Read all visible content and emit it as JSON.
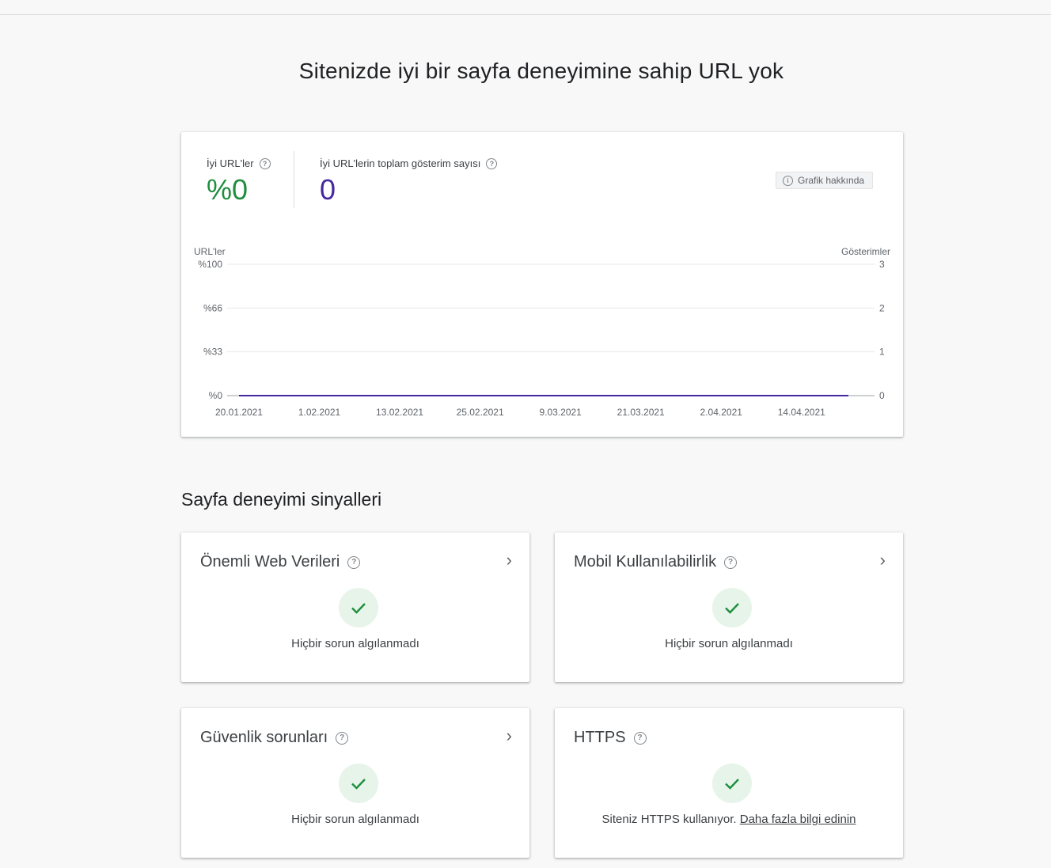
{
  "page": {
    "title": "Sitenizde iyi bir sayfa deneyimine sahip URL yok"
  },
  "summary": {
    "good_urls_label": "İyi URL'ler",
    "good_urls_value": "%0",
    "impressions_label": "İyi URL'lerin toplam gösterim sayısı",
    "impressions_value": "0",
    "about_chart_label": "Grafik hakkında"
  },
  "colors": {
    "good_green": "#1e8e3e",
    "impressions_purple": "#4527a0",
    "check_green": "#1e8e3e",
    "check_bg": "#e6f4ea"
  },
  "chart_data": {
    "type": "line",
    "left_axis_label": "URL'ler",
    "right_axis_label": "Gösterimler",
    "left_ticks": [
      "%100",
      "%66",
      "%33",
      "%0"
    ],
    "right_ticks": [
      "3",
      "2",
      "1",
      "0"
    ],
    "x_tick_labels": [
      "20.01.2021",
      "1.02.2021",
      "13.02.2021",
      "25.02.2021",
      "9.03.2021",
      "21.03.2021",
      "2.04.2021",
      "14.04.2021"
    ],
    "x_range": [
      "20.01.2021",
      "21.04.2021"
    ],
    "ylim_left": [
      0,
      100
    ],
    "ylim_right": [
      0,
      3
    ],
    "grid": true,
    "series": [
      {
        "axis": "right",
        "color": "#4527a0",
        "x": [
          "20.01.2021",
          "21.04.2021"
        ],
        "values": [
          0,
          0
        ]
      }
    ]
  },
  "signals": {
    "section_title": "Sayfa deneyimi sinyalleri",
    "items": [
      {
        "title": "Önemli Web Verileri",
        "status": "Hiçbir sorun algılanmadı",
        "has_chevron": true
      },
      {
        "title": "Mobil Kullanılabilirlik",
        "status": "Hiçbir sorun algılanmadı",
        "has_chevron": true
      },
      {
        "title": "Güvenlik sorunları",
        "status": "Hiçbir sorun algılanmadı",
        "has_chevron": true
      },
      {
        "title": "HTTPS",
        "status": "Siteniz HTTPS kullanıyor.",
        "link": "Daha fazla bilgi edinin",
        "has_chevron": false
      }
    ]
  },
  "icons": {
    "help": "help-circle-icon",
    "info": "info-icon",
    "chevron": "chevron-right-icon",
    "check": "check-icon"
  }
}
